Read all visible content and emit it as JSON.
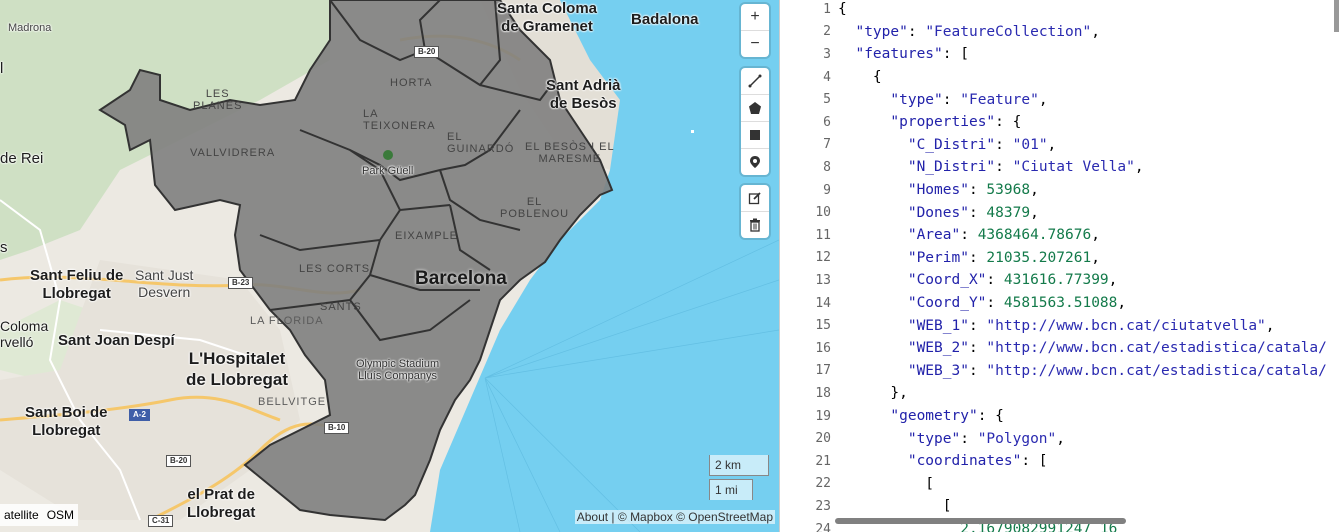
{
  "map": {
    "labels": {
      "sta_coloma": "Santa Coloma\nde Gramenet",
      "badalona": "Badalona",
      "sant_adria": "Sant Adrià\nde Besòs",
      "sant_feliu": "Sant Feliu de\nLlobregat",
      "sant_just": "Sant Just\nDesvern",
      "sant_joan": "Sant Joan Despí",
      "hospitalet": "L'Hospitalet\nde Llobregat",
      "sant_boi": "Sant Boi de\nLlobregat",
      "el_prat": "el Prat de\nLlobregat",
      "barcelona": "Barcelona",
      "madrona": "Madrona",
      "de_rei": "de Rei",
      "coloma": "Coloma",
      "cervello": "rvelló",
      "la_florida": "LA FLORIDA",
      "bellvitge": "BELLVITGE",
      "horta": "HORTA",
      "els_planes": "LES\nPLANES",
      "la_teixonera": "LA\nTEIXONERA",
      "el_guinardo": "EL\nGUINARDÓ",
      "vallvidrera": "VALLVIDRERA",
      "park_guell": "Park Güell",
      "el_besos": "EL BESÒS I EL\nMARESME",
      "el_poblenou": "EL\nPOBLENOU",
      "eixample": "EIXAMPLE",
      "les_corts": "LES CORTS",
      "sants": "SANTS",
      "olympic": "Olympic Stadium\nLluís Companys",
      "l_char": "l",
      "s_char": "s"
    },
    "roads": {
      "b20_top": "B-20",
      "b23": "B-23",
      "a2": "A-2",
      "b10": "B-10",
      "b20_bottom": "B-20",
      "c31": "C-31"
    },
    "controls": {
      "zoom_in": "+",
      "zoom_out": "−",
      "line_icon": "line-draw-icon",
      "polygon_icon": "polygon-draw-icon",
      "rectangle_icon": "rectangle-draw-icon",
      "marker_icon": "marker-icon",
      "edit_icon": "edit-icon",
      "trash_icon": "trash-icon"
    },
    "scale": {
      "km": "2 km",
      "mi": "1 mi"
    },
    "layers": {
      "satellite": "atellite",
      "osm": "OSM"
    },
    "attribution": {
      "about": "About",
      "sep1": " | © ",
      "mapbox": "Mapbox",
      "sep2": " © ",
      "osm": "OpenStreetMap"
    },
    "colors": {
      "water": "#75cff0",
      "district_fill": "#7f7f7f",
      "district_stroke": "#333333",
      "land": "#ece9e2"
    }
  },
  "editor": {
    "lines": [
      [
        [
          "p",
          "{"
        ]
      ],
      [
        [
          "p",
          "  "
        ],
        [
          "k",
          "\"type\""
        ],
        [
          "p",
          ": "
        ],
        [
          "s",
          "\"FeatureCollection\""
        ],
        [
          "p",
          ","
        ]
      ],
      [
        [
          "p",
          "  "
        ],
        [
          "k",
          "\"features\""
        ],
        [
          "p",
          ": ["
        ]
      ],
      [
        [
          "p",
          "    {"
        ]
      ],
      [
        [
          "p",
          "      "
        ],
        [
          "k",
          "\"type\""
        ],
        [
          "p",
          ": "
        ],
        [
          "s",
          "\"Feature\""
        ],
        [
          "p",
          ","
        ]
      ],
      [
        [
          "p",
          "      "
        ],
        [
          "k",
          "\"properties\""
        ],
        [
          "p",
          ": {"
        ]
      ],
      [
        [
          "p",
          "        "
        ],
        [
          "k",
          "\"C_Distri\""
        ],
        [
          "p",
          ": "
        ],
        [
          "s",
          "\"01\""
        ],
        [
          "p",
          ","
        ]
      ],
      [
        [
          "p",
          "        "
        ],
        [
          "k",
          "\"N_Distri\""
        ],
        [
          "p",
          ": "
        ],
        [
          "s",
          "\"Ciutat Vella\""
        ],
        [
          "p",
          ","
        ]
      ],
      [
        [
          "p",
          "        "
        ],
        [
          "k",
          "\"Homes\""
        ],
        [
          "p",
          ": "
        ],
        [
          "n",
          "53968"
        ],
        [
          "p",
          ","
        ]
      ],
      [
        [
          "p",
          "        "
        ],
        [
          "k",
          "\"Dones\""
        ],
        [
          "p",
          ": "
        ],
        [
          "n",
          "48379"
        ],
        [
          "p",
          ","
        ]
      ],
      [
        [
          "p",
          "        "
        ],
        [
          "k",
          "\"Area\""
        ],
        [
          "p",
          ": "
        ],
        [
          "n",
          "4368464.78676"
        ],
        [
          "p",
          ","
        ]
      ],
      [
        [
          "p",
          "        "
        ],
        [
          "k",
          "\"Perim\""
        ],
        [
          "p",
          ": "
        ],
        [
          "n",
          "21035.207261"
        ],
        [
          "p",
          ","
        ]
      ],
      [
        [
          "p",
          "        "
        ],
        [
          "k",
          "\"Coord_X\""
        ],
        [
          "p",
          ": "
        ],
        [
          "n",
          "431616.77399"
        ],
        [
          "p",
          ","
        ]
      ],
      [
        [
          "p",
          "        "
        ],
        [
          "k",
          "\"Coord_Y\""
        ],
        [
          "p",
          ": "
        ],
        [
          "n",
          "4581563.51088"
        ],
        [
          "p",
          ","
        ]
      ],
      [
        [
          "p",
          "        "
        ],
        [
          "k",
          "\"WEB_1\""
        ],
        [
          "p",
          ": "
        ],
        [
          "s",
          "\"http://www.bcn.cat/ciutatvella\""
        ],
        [
          "p",
          ","
        ]
      ],
      [
        [
          "p",
          "        "
        ],
        [
          "k",
          "\"WEB_2\""
        ],
        [
          "p",
          ": "
        ],
        [
          "s",
          "\"http://www.bcn.cat/estadistica/catala/"
        ]
      ],
      [
        [
          "p",
          "        "
        ],
        [
          "k",
          "\"WEB_3\""
        ],
        [
          "p",
          ": "
        ],
        [
          "s",
          "\"http://www.bcn.cat/estadistica/catala/"
        ]
      ],
      [
        [
          "p",
          "      },"
        ]
      ],
      [
        [
          "p",
          "      "
        ],
        [
          "k",
          "\"geometry\""
        ],
        [
          "p",
          ": {"
        ]
      ],
      [
        [
          "p",
          "        "
        ],
        [
          "k",
          "\"type\""
        ],
        [
          "p",
          ": "
        ],
        [
          "s",
          "\"Polygon\""
        ],
        [
          "p",
          ","
        ]
      ],
      [
        [
          "p",
          "        "
        ],
        [
          "k",
          "\"coordinates\""
        ],
        [
          "p",
          ": ["
        ]
      ],
      [
        [
          "p",
          "          ["
        ]
      ],
      [
        [
          "p",
          "            ["
        ]
      ]
    ],
    "line_numbers": [
      "1",
      "2",
      "3",
      "4",
      "5",
      "6",
      "7",
      "8",
      "9",
      "10",
      "11",
      "12",
      "13",
      "14",
      "15",
      "16",
      "17",
      "18",
      "19",
      "20",
      "21",
      "22",
      "23",
      "24"
    ],
    "partial_last": "              2.1679082991247 16"
  }
}
